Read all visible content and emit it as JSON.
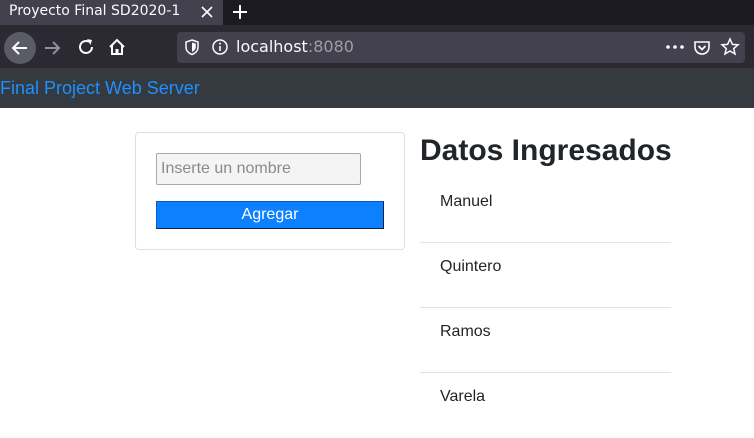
{
  "browser": {
    "tab_title": "Proyecto Final SD2020-1",
    "url_host": "localhost",
    "url_port": ":8080"
  },
  "header": {
    "brand": "Final Project Web Server"
  },
  "form": {
    "name_placeholder": "Inserte un nombre",
    "name_value": "",
    "add_label": "Agregar"
  },
  "results": {
    "title": "Datos Ingresados",
    "items": [
      "Manuel",
      "Quintero",
      "Ramos",
      "Varela"
    ]
  },
  "colors": {
    "brand_link": "#1e90ff",
    "header_bg": "#343a40",
    "button_bg": "#0d80ff"
  }
}
